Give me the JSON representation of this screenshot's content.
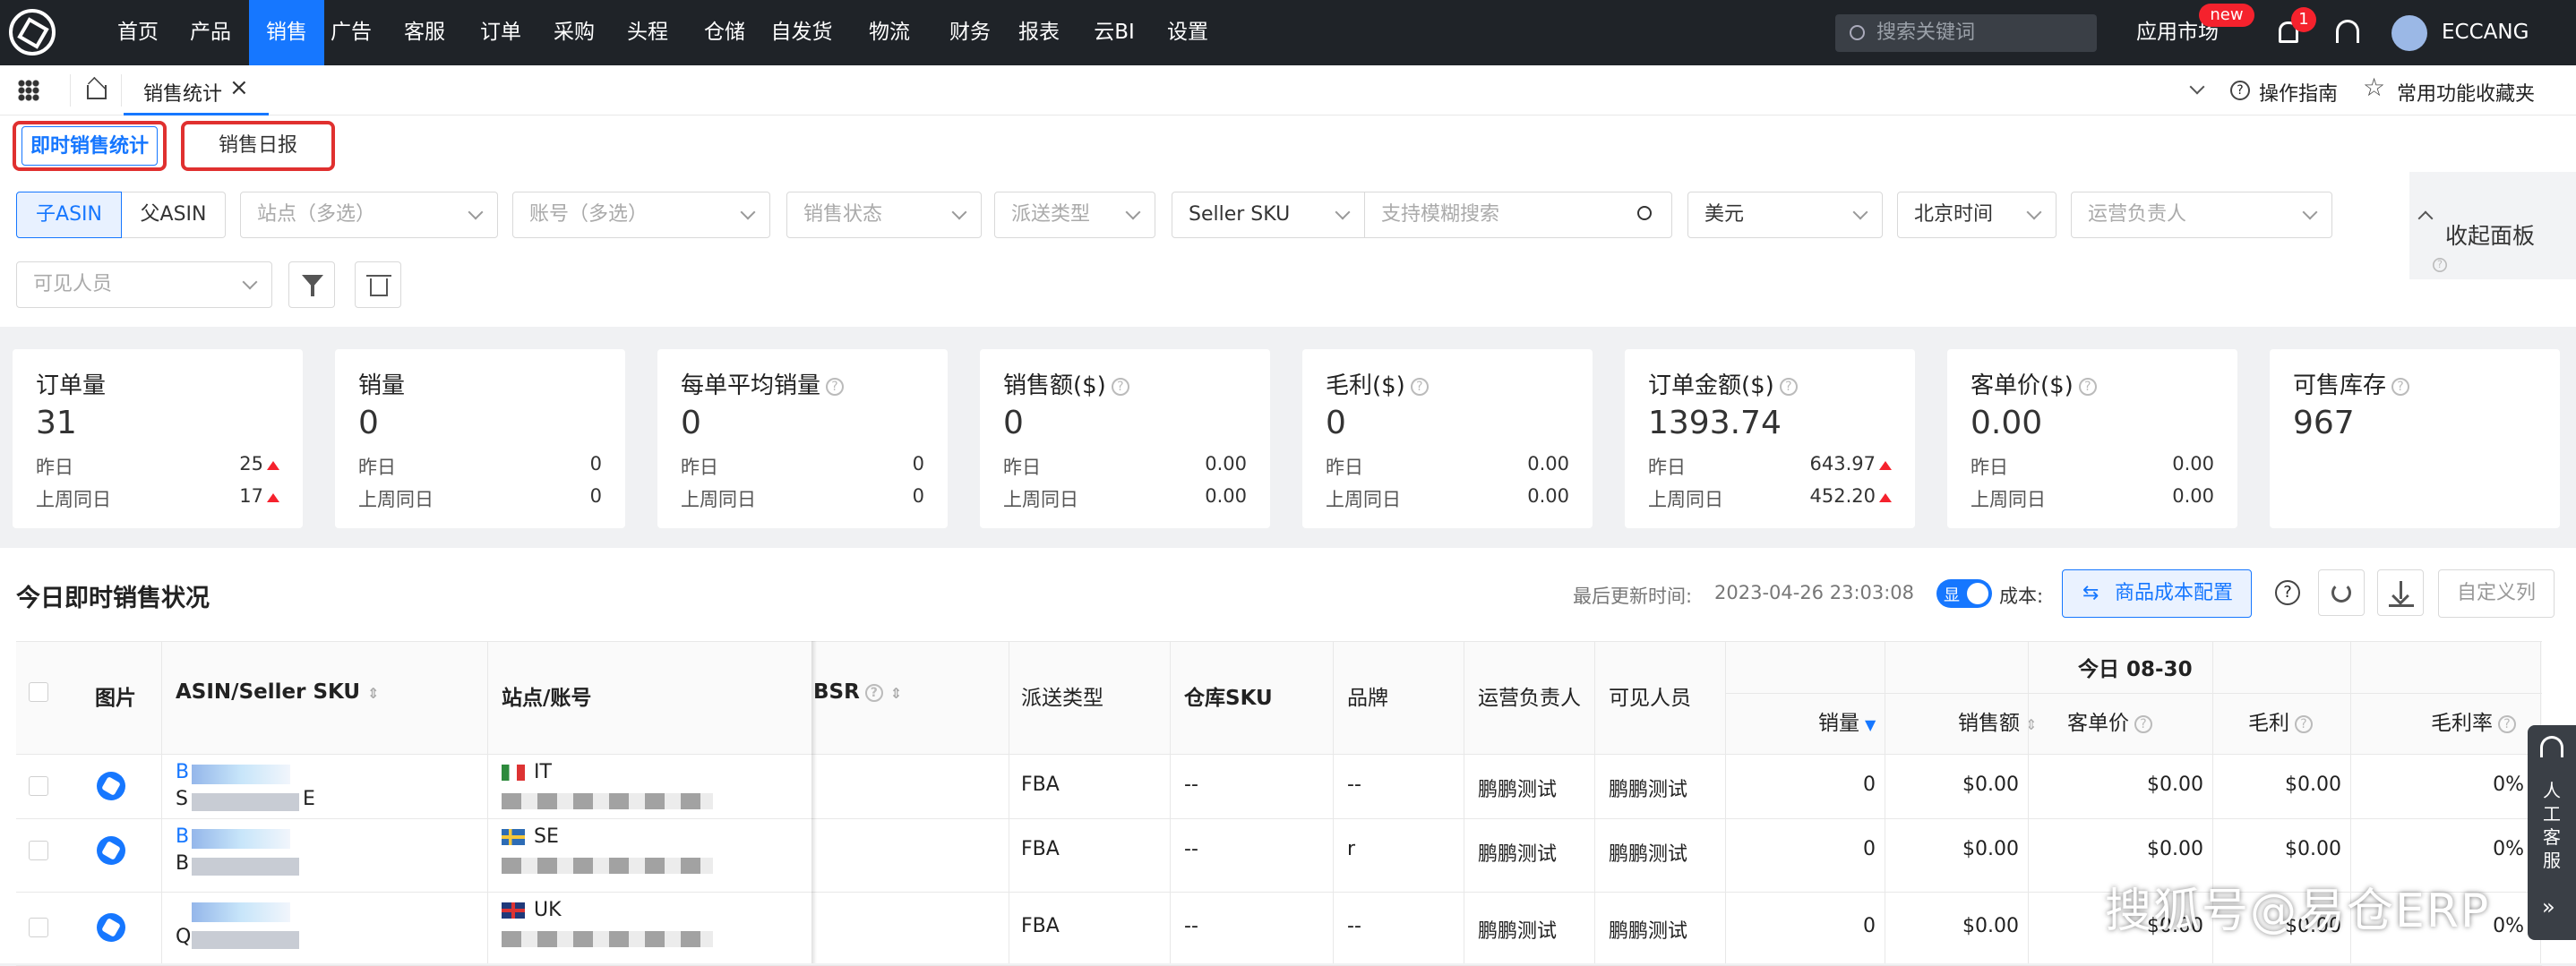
{
  "nav": [
    "首页",
    "产品",
    "销售",
    "广告",
    "客服",
    "订单",
    "采购",
    "头程",
    "仓储",
    "自发货",
    "物流",
    "财务",
    "报表",
    "云BI",
    "设置"
  ],
  "header": {
    "search_placeholder": "搜索关键词",
    "app_market": "应用市场",
    "new_badge": "new",
    "notif_count": "1",
    "username": "ECCANG"
  },
  "tabs": {
    "page_tab": "销售统计",
    "guide": "操作指南",
    "favorites": "常用功能收藏夹"
  },
  "subtabs": {
    "realtime": "即时销售统计",
    "daily": "销售日报"
  },
  "filters": {
    "child_asin": "子ASIN",
    "parent_asin": "父ASIN",
    "site": "站点（多选）",
    "account": "账号（多选）",
    "sales_status": "销售状态",
    "delivery_type": "派送类型",
    "sku_type": "Seller SKU",
    "fuzzy_search": "支持模糊搜索",
    "currency": "美元",
    "timezone": "北京时间",
    "operator": "运营负责人",
    "visible_user": "可见人员",
    "collapse": "收起面板"
  },
  "cards": [
    {
      "title": "订单量",
      "value": "31",
      "y_label": "昨日",
      "y_val": "25",
      "w_label": "上周同日",
      "w_val": "17",
      "help": false,
      "yu": true,
      "wu": true
    },
    {
      "title": "销量",
      "value": "0",
      "y_label": "昨日",
      "y_val": "0",
      "w_label": "上周同日",
      "w_val": "0",
      "help": false,
      "yu": false,
      "wu": false
    },
    {
      "title": "每单平均销量",
      "value": "0",
      "y_label": "昨日",
      "y_val": "0",
      "w_label": "上周同日",
      "w_val": "0",
      "help": true,
      "yu": false,
      "wu": false
    },
    {
      "title": "销售额($)",
      "value": "0",
      "y_label": "昨日",
      "y_val": "0.00",
      "w_label": "上周同日",
      "w_val": "0.00",
      "help": true,
      "yu": false,
      "wu": false
    },
    {
      "title": "毛利($)",
      "value": "0",
      "y_label": "昨日",
      "y_val": "0.00",
      "w_label": "上周同日",
      "w_val": "0.00",
      "help": true,
      "yu": false,
      "wu": false
    },
    {
      "title": "订单金额($)",
      "value": "1393.74",
      "y_label": "昨日",
      "y_val": "643.97",
      "w_label": "上周同日",
      "w_val": "452.20",
      "help": true,
      "yu": true,
      "wu": true
    },
    {
      "title": "客单价($)",
      "value": "0.00",
      "y_label": "昨日",
      "y_val": "0.00",
      "w_label": "上周同日",
      "w_val": "0.00",
      "help": true,
      "yu": false,
      "wu": false
    },
    {
      "title": "可售库存",
      "value": "967",
      "help": true
    }
  ],
  "section": {
    "title": "今日即时销售状况",
    "last_update_label": "最后更新时间:",
    "last_update": "2023-04-26 23:03:08",
    "toggle_text": "显",
    "cost_label": "成本:",
    "cost_config": "商品成本配置",
    "custom_cols": "自定义列"
  },
  "table": {
    "headers": {
      "image": "图片",
      "asin": "ASIN/Seller SKU",
      "site": "站点/账号",
      "bsr": "BSR",
      "delivery": "派送类型",
      "warehouse_sku": "仓库SKU",
      "brand": "品牌",
      "operator": "运营负责人",
      "visible": "可见人员",
      "today": "今日 08-30",
      "qty": "销量",
      "amount": "销售额",
      "unit_price": "客单价",
      "profit": "毛利",
      "margin": "毛利率"
    },
    "rows": [
      {
        "asin": "B",
        "sku": "S",
        "sku_tail": "E",
        "site": "IT",
        "delivery": "FBA",
        "warehouse_sku": "--",
        "brand": "--",
        "operator": "鹏鹏测试",
        "visible": "鹏鹏测试",
        "qty": "0",
        "amount": "$0.00",
        "unit_price": "$0.00",
        "profit": "$0.00",
        "margin": "0%"
      },
      {
        "asin": "B",
        "sku": "B",
        "sku_tail": "",
        "site": "SE",
        "delivery": "FBA",
        "warehouse_sku": "--",
        "brand": "r",
        "operator": "鹏鹏测试",
        "visible": "鹏鹏测试",
        "qty": "0",
        "amount": "$0.00",
        "unit_price": "$0.00",
        "profit": "$0.00",
        "margin": "0%"
      },
      {
        "asin": "",
        "sku": "Q",
        "sku_tail": "",
        "site": "UK",
        "delivery": "FBA",
        "warehouse_sku": "--",
        "brand": "--",
        "operator": "鹏鹏测试",
        "visible": "鹏鹏测试",
        "qty": "0",
        "amount": "$0.00",
        "unit_price": "$0.00",
        "profit": "$0.00",
        "margin": "0%"
      }
    ]
  },
  "side_service": "人工客服",
  "watermark": "搜狐号@易仓ERP"
}
